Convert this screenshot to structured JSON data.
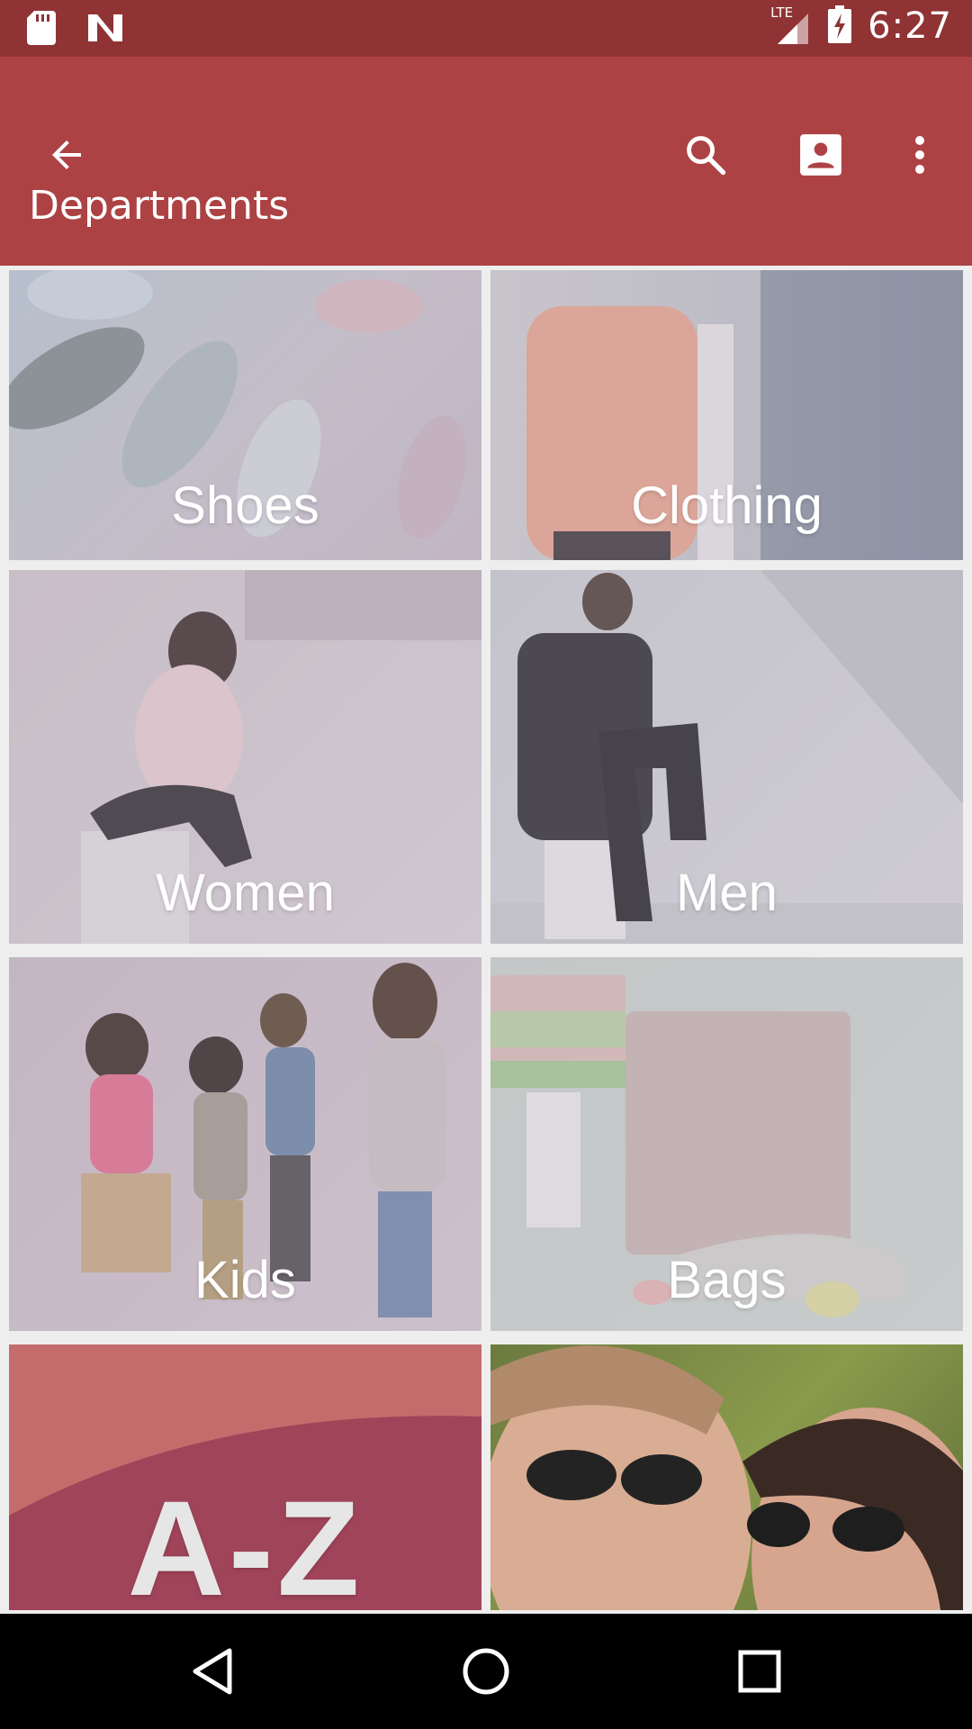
{
  "status_bar": {
    "time": "6:27",
    "network": "LTE",
    "left_icons": [
      "sd-card-icon",
      "n-notification-icon"
    ],
    "right_icons": [
      "signal-icon",
      "battery-charging-icon"
    ]
  },
  "app_bar": {
    "title": "Departments",
    "actions": [
      "back-arrow-icon",
      "search-icon",
      "account-icon",
      "more-vert-icon"
    ],
    "color": "#ad4244"
  },
  "departments": [
    {
      "label": "Shoes"
    },
    {
      "label": "Clothing"
    },
    {
      "label": "Women"
    },
    {
      "label": "Men"
    },
    {
      "label": "Kids"
    },
    {
      "label": "Bags"
    },
    {
      "label": "A-Z"
    },
    {
      "label": ""
    }
  ],
  "nav_bar": {
    "buttons": [
      "back-triangle-icon",
      "home-circle-icon",
      "recents-square-icon"
    ]
  }
}
